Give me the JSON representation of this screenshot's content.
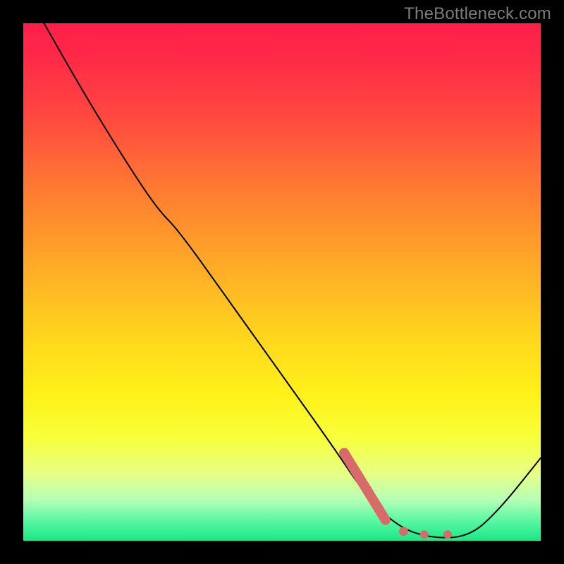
{
  "watermark": "TheBottleneck.com",
  "colors": {
    "bar": "#d86a6a",
    "curve": "#000000",
    "gradient_top": "#ff1f4a",
    "gradient_bottom": "#18e885"
  },
  "chart_data": {
    "type": "line",
    "title": "",
    "xlabel": "",
    "ylabel": "",
    "x_range": [
      0,
      100
    ],
    "y_range": [
      0,
      100
    ],
    "curve": [
      {
        "x": 4,
        "y": 100
      },
      {
        "x": 12,
        "y": 86
      },
      {
        "x": 20,
        "y": 73
      },
      {
        "x": 26,
        "y": 64
      },
      {
        "x": 30,
        "y": 60
      },
      {
        "x": 40,
        "y": 46
      },
      {
        "x": 50,
        "y": 32
      },
      {
        "x": 60,
        "y": 18
      },
      {
        "x": 66,
        "y": 9
      },
      {
        "x": 72,
        "y": 3
      },
      {
        "x": 78,
        "y": 0.6
      },
      {
        "x": 86,
        "y": 0.6
      },
      {
        "x": 92,
        "y": 6
      },
      {
        "x": 100,
        "y": 16
      }
    ],
    "highlight_bar": {
      "x1": 62,
      "y1": 17,
      "x2": 70,
      "y2": 4
    },
    "highlight_dots": [
      {
        "x": 73.5,
        "y": 1.8
      },
      {
        "x": 77.5,
        "y": 1.2
      },
      {
        "x": 82,
        "y": 1.2
      }
    ]
  }
}
